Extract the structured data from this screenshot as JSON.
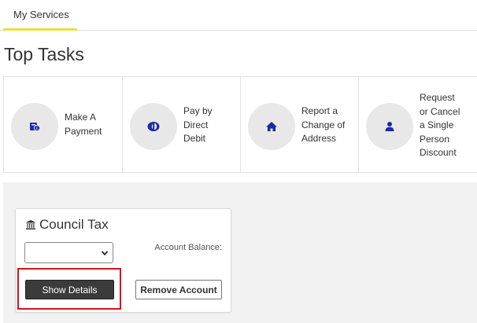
{
  "tabs": [
    {
      "label": "My Services",
      "active": true
    }
  ],
  "page_title": "Top Tasks",
  "tasks": [
    {
      "label_lines": [
        "Make A",
        "Payment"
      ],
      "icon": "payment-icon"
    },
    {
      "label_lines": [
        "Pay by",
        "Direct",
        "Debit"
      ],
      "icon": "direct-debit-icon"
    },
    {
      "label_lines": [
        "Report a",
        "Change of",
        "Address"
      ],
      "icon": "home-icon"
    },
    {
      "label_lines": [
        "Request",
        "or Cancel",
        "a Single",
        "Person",
        "Discount"
      ],
      "icon": "person-icon"
    }
  ],
  "account_card": {
    "title": "Council Tax",
    "title_icon": "building-icon",
    "select_value": "",
    "balance_label": "Account Balance:",
    "show_details_label": "Show Details",
    "remove_account_label": "Remove Account"
  },
  "colors": {
    "tab_underline": "#e5e045",
    "icon_blue": "#1f2a9e",
    "highlight_red": "#d4151b",
    "button_dark": "#3b3b3b"
  }
}
